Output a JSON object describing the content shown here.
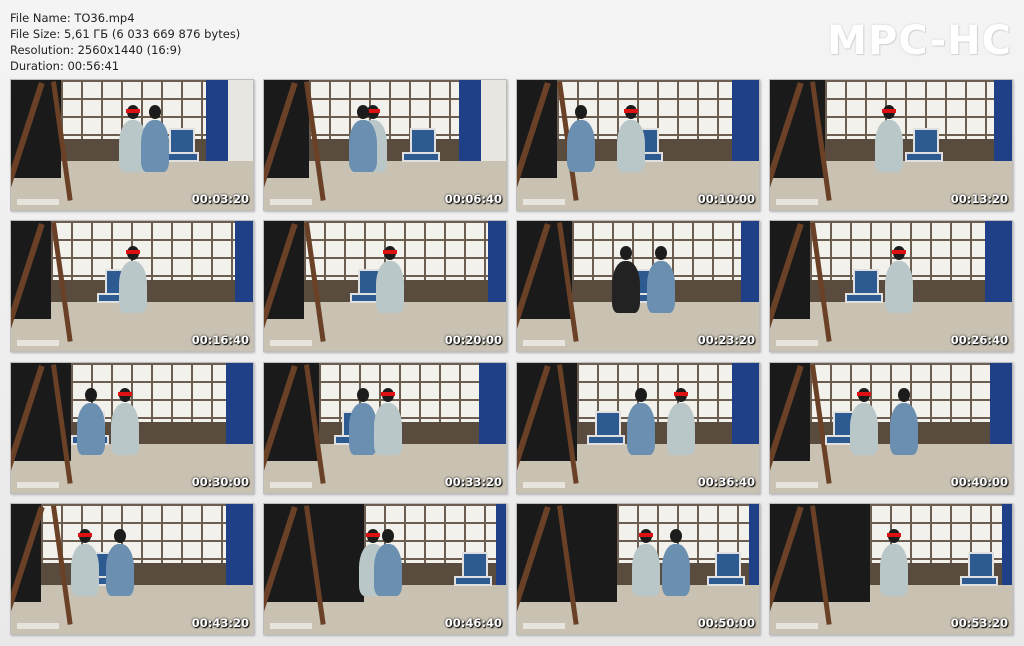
{
  "info": {
    "file_name": "File Name: TO36.mp4",
    "file_size": "File Size: 5,61 ГБ (6 033 669 876 bytes)",
    "resolution": "Resolution: 2560x1440 (16:9)",
    "duration": "Duration: 00:56:41"
  },
  "logo": "MPC-HC",
  "thumbnails": [
    {
      "time": "00:03:20"
    },
    {
      "time": "00:06:40"
    },
    {
      "time": "00:10:00"
    },
    {
      "time": "00:13:20"
    },
    {
      "time": "00:16:40"
    },
    {
      "time": "00:20:00"
    },
    {
      "time": "00:23:20"
    },
    {
      "time": "00:26:40"
    },
    {
      "time": "00:30:00"
    },
    {
      "time": "00:33:20"
    },
    {
      "time": "00:36:40"
    },
    {
      "time": "00:40:00"
    },
    {
      "time": "00:43:20"
    },
    {
      "time": "00:46:40"
    },
    {
      "time": "00:50:00"
    },
    {
      "time": "00:53:20"
    }
  ],
  "colors": {
    "background": "#eeeeee",
    "text": "#222222",
    "logo": "#ffffff",
    "timestamp": "#ffffff",
    "curtain": "#1f3f86",
    "chair": "#2e5a92",
    "blindfold": "#dd1111"
  }
}
